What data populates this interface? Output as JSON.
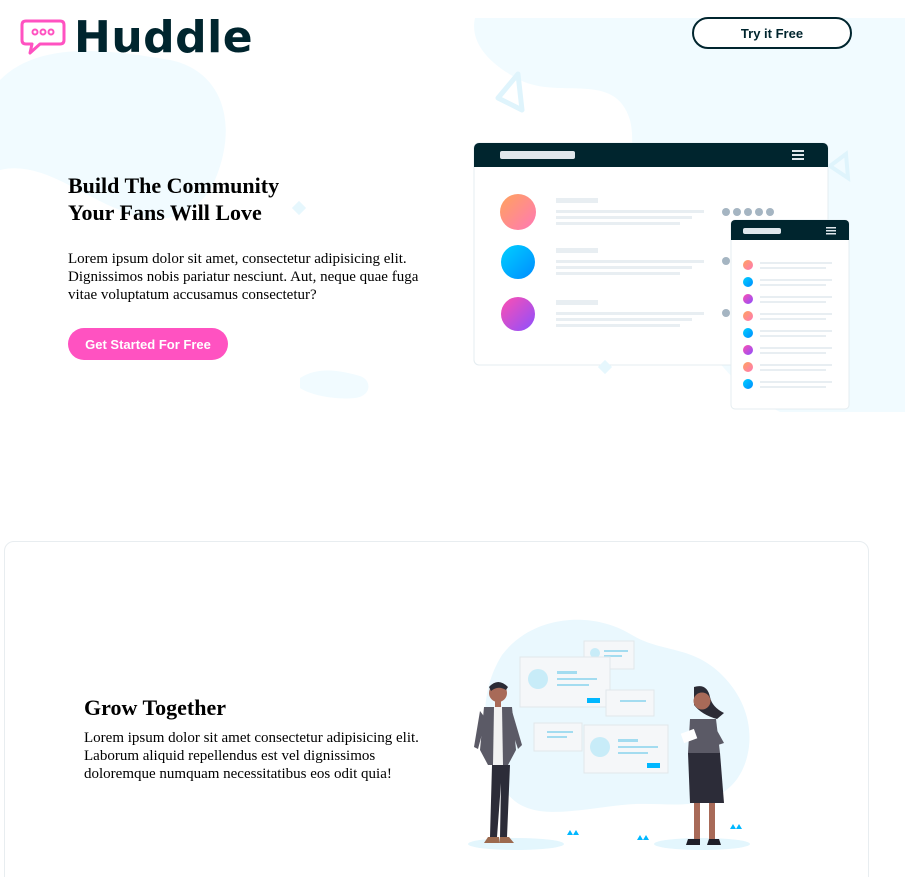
{
  "header": {
    "logo_text": "Huddle",
    "cta_label": "Try it Free"
  },
  "hero": {
    "title_line1": "Build The Community",
    "title_line2": "Your Fans Will Love",
    "text": "Lorem ipsum dolor sit amet, consectetur adipisicing elit. Dignissimos nobis pariatur nesciunt. Aut, neque quae fuga vitae voluptatum accusamus consectetur?",
    "cta_label": "Get Started For Free"
  },
  "feature": {
    "title": "Grow Together",
    "text": "Lorem ipsum dolor sit amet consectetur adipisicing elit. Laborum aliquid repellendus est vel dignissimos doloremque numquam necessitatibus eos odit quia!"
  },
  "colors": {
    "dark": "#00252e",
    "pink": "#ff52c1",
    "blue": "#00a8ff",
    "bg_blue": "#f0fbff"
  }
}
